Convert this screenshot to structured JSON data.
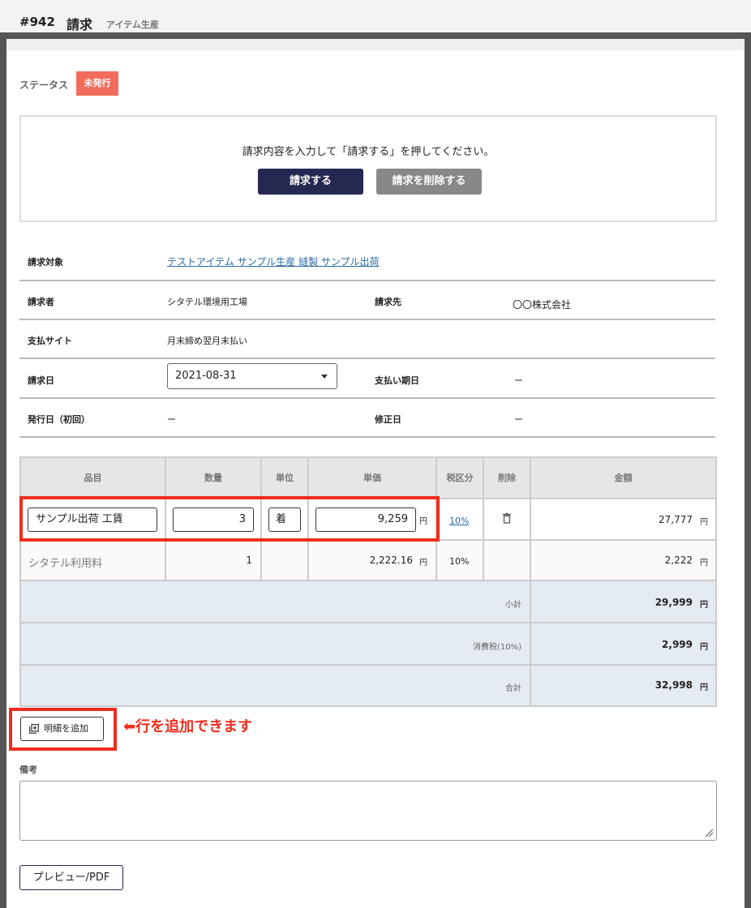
{
  "header": {
    "number": "#942",
    "title": "請求",
    "subtitle": "アイテム生産"
  },
  "status": {
    "label": "ステータス",
    "badge": "未発行",
    "badge_color": "#f26c5b"
  },
  "notice": {
    "message": "請求内容を入力して「請求する」を押してください。",
    "invoice_button": "請求する",
    "delete_button": "請求を削除する"
  },
  "info": {
    "target_label": "請求対象",
    "target_link": "テストアイテム サンプル生産 縫製 サンプル出荷",
    "biller_label": "請求者",
    "biller_value": "シタテル環境用工場",
    "billto_label": "請求先",
    "billto_value": "〇〇株式会社",
    "payment_site_label": "支払サイト",
    "payment_site_value": "月末締め翌月末払い",
    "invoice_date_label": "請求日",
    "invoice_date_value": "2021-08-31",
    "due_date_label": "支払い期日",
    "due_date_value": "ー",
    "issue_date_label": "発行日（初回）",
    "issue_date_value": "ー",
    "revised_label": "修正日",
    "revised_value": "ー"
  },
  "table": {
    "headers": {
      "item": "品目",
      "qty": "数量",
      "unit": "単位",
      "price": "単価",
      "tax": "税区分",
      "del": "削除",
      "amount": "金額"
    },
    "rows": [
      {
        "item": "サンプル出荷 工賃",
        "qty": "3",
        "unit": "着",
        "price": "9,259",
        "tax": "10%",
        "amount": "27,777"
      },
      {
        "item": "シタテル利用料",
        "qty": "1",
        "unit": "",
        "price": "2,222.16",
        "tax": "10%",
        "amount": "2,222"
      }
    ],
    "yen": "円",
    "subtotal_label": "小計",
    "subtotal_value": "29,999",
    "tax_label": "消費税(10%)",
    "tax_value": "2,999",
    "total_label": "合計",
    "total_value": "32,998"
  },
  "add_row_button": "明細を追加",
  "annotation": "⬅行を追加できます",
  "memo_label": "備考",
  "preview_button": "プレビュー/PDF"
}
